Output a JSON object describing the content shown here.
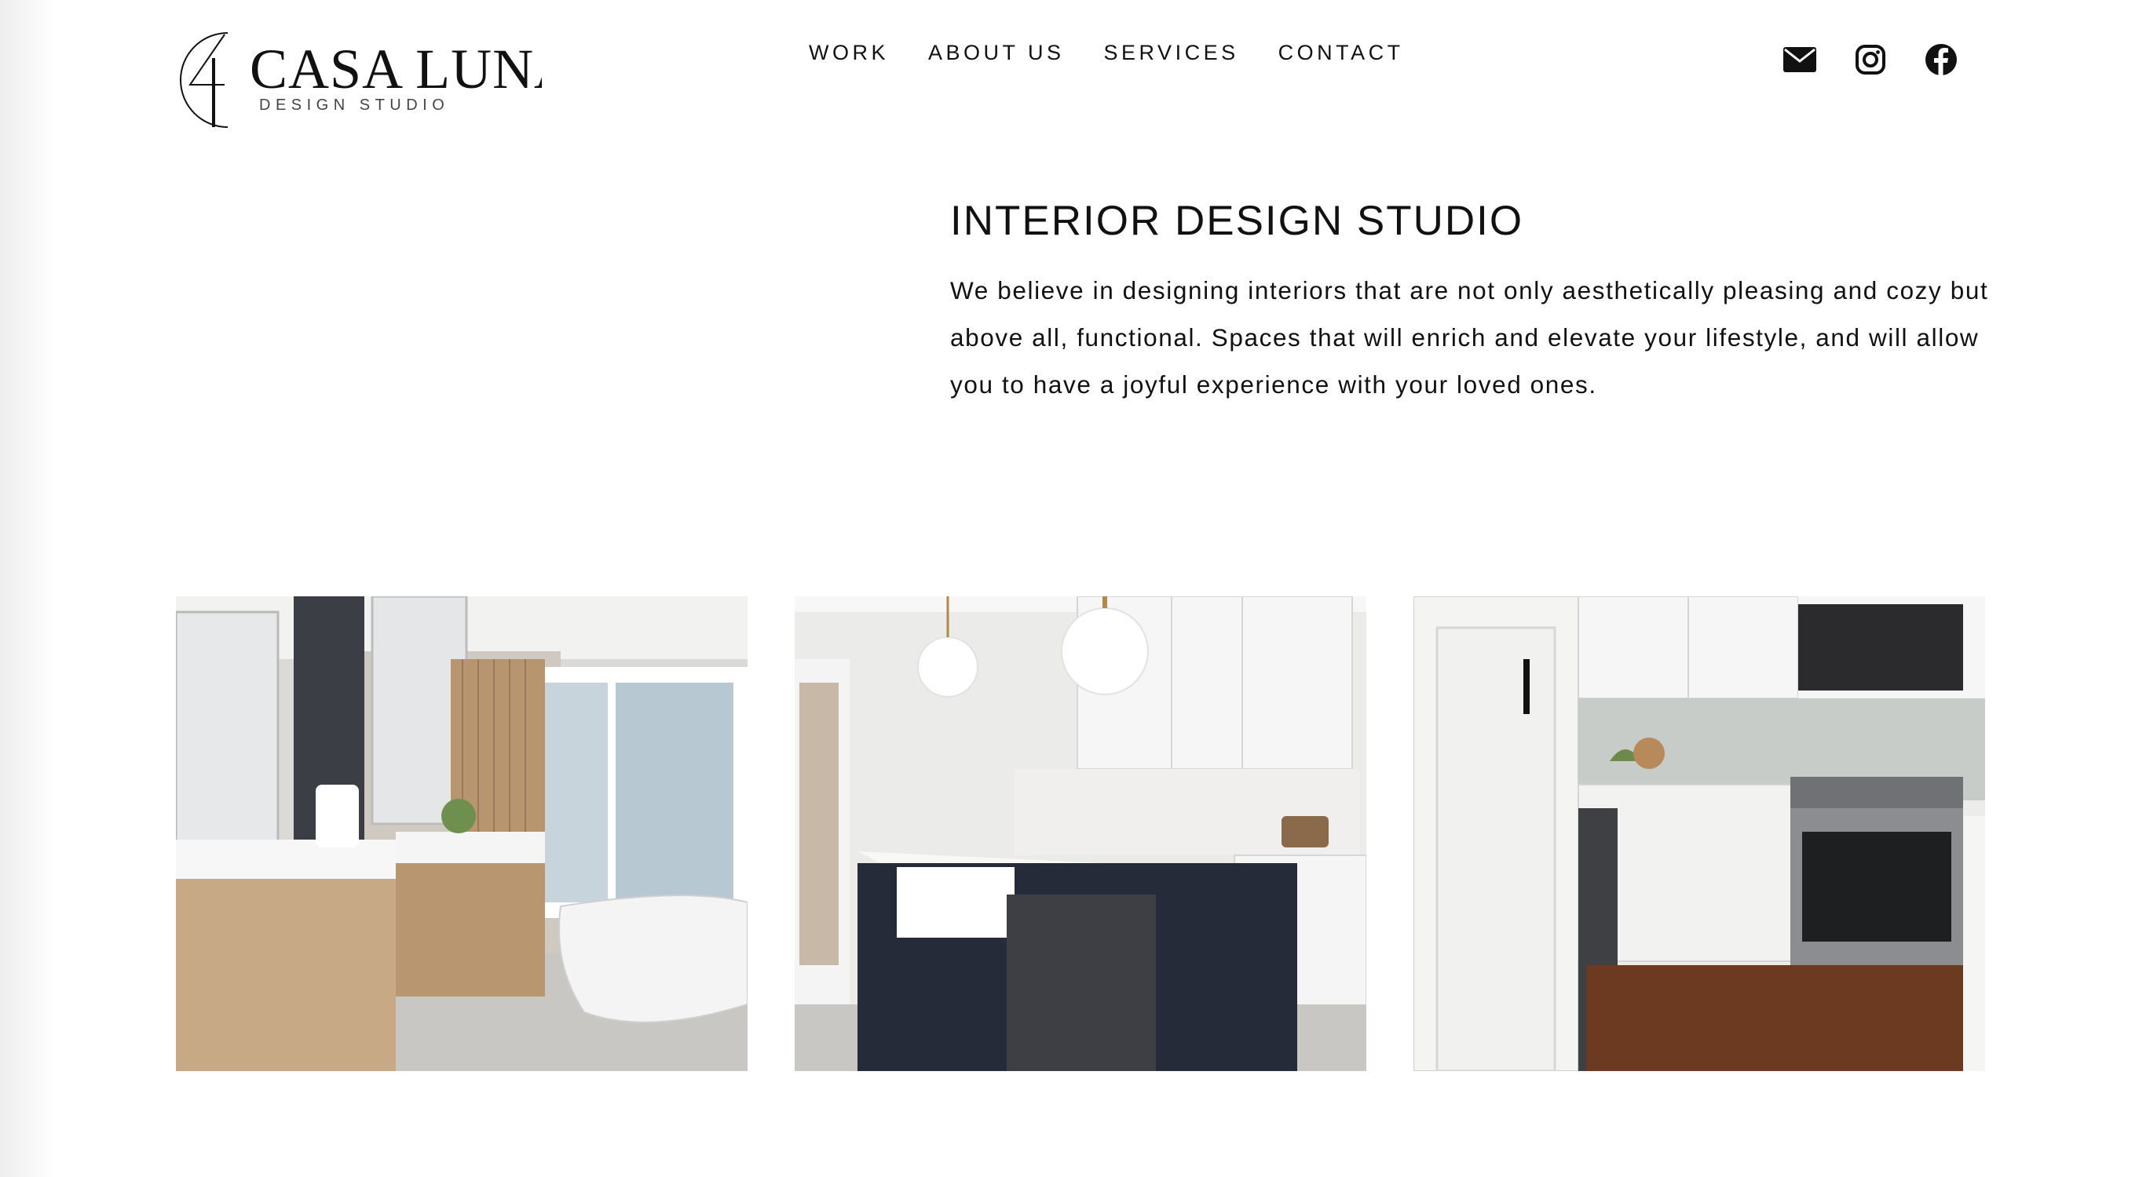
{
  "brand": {
    "name": "CASA LUNA",
    "tagline": "DESIGN STUDIO"
  },
  "nav": {
    "items": [
      {
        "label": "WORK"
      },
      {
        "label": "ABOUT US"
      },
      {
        "label": "SERVICES"
      },
      {
        "label": "CONTACT"
      }
    ]
  },
  "social": {
    "icons": [
      "email-icon",
      "instagram-icon",
      "facebook-icon"
    ]
  },
  "intro": {
    "title": "INTERIOR DESIGN STUDIO",
    "lines": [
      "We believe in designing interiors that are not only aesthetically pleasing and cozy but",
      "above all, functional. Spaces that will enrich and elevate your lifestyle, and will allow",
      "you to have a joyful experience with your loved ones."
    ]
  },
  "gallery": {
    "photos": [
      {
        "subject": "bathroom"
      },
      {
        "subject": "kitchen-island"
      },
      {
        "subject": "kitchen-range"
      }
    ]
  },
  "colors": {
    "text": "#111111",
    "background": "#ffffff",
    "island_navy": "#262b3a"
  }
}
